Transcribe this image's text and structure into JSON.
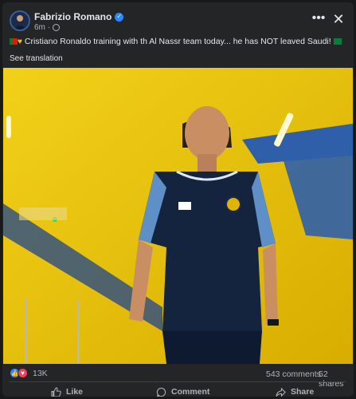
{
  "post": {
    "author": "Fabrizio Romano",
    "time": "6m",
    "text": "Cristiano Ronaldo training with th Al Nassr team today... he has NOT leaved Saudi!",
    "see_translation": "See translation"
  },
  "header": {
    "more_icon": "more-horizontal-icon",
    "close_icon": "close-icon"
  },
  "stats": {
    "reactions": "13K",
    "comments": "543 comments",
    "shares": "52 shares"
  },
  "actions": {
    "like": "Like",
    "comment": "Comment",
    "share": "Share"
  },
  "colors": {
    "background": "#18191a",
    "card": "#242526",
    "text": "#e4e6eb",
    "muted": "#b0b3b8",
    "accent": "#2d88ff",
    "photo_yellow": "#e9c200"
  }
}
